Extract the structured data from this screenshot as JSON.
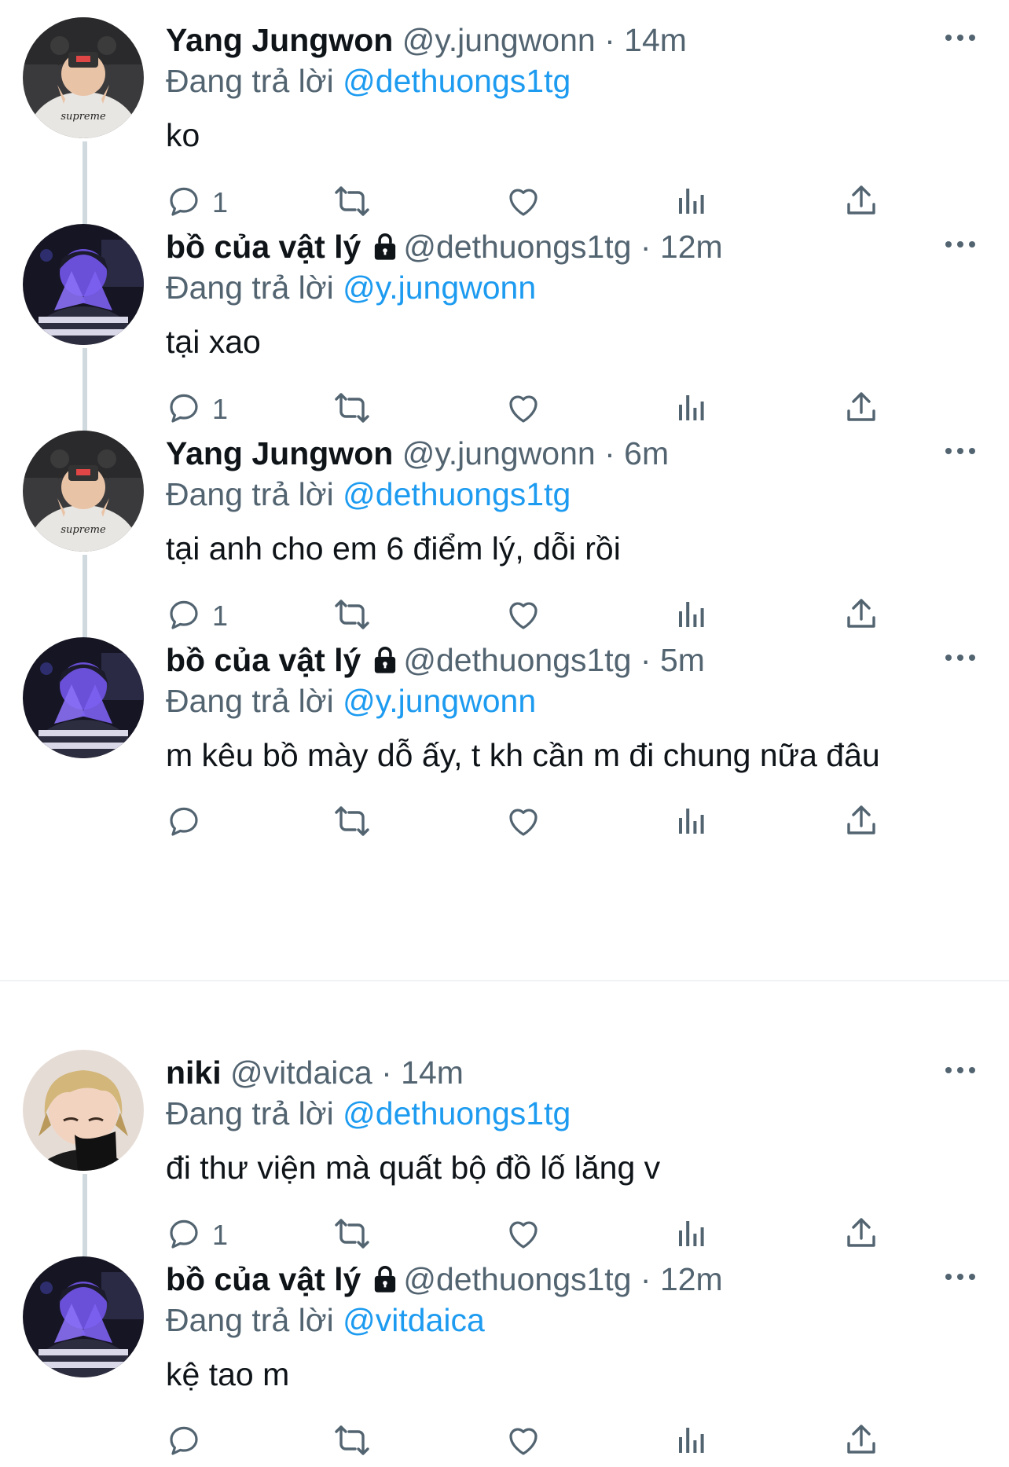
{
  "tweets": [
    {
      "name": "Yang Jungwon",
      "handle": "@y.jungwonn",
      "time": "· 14m",
      "locked": false,
      "reply_prefix": "Đang trả lời",
      "reply_to": "@dethuongs1tg",
      "text": "ko",
      "reply_count": "1",
      "avatar": "avatar-jungwon"
    },
    {
      "name": "bồ của vật lý",
      "handle": "@dethuongs1tg",
      "time": "· 12m",
      "locked": true,
      "reply_prefix": "Đang trả lời",
      "reply_to": "@y.jungwonn",
      "text": "tại xao",
      "reply_count": "1",
      "avatar": "avatar-blue"
    },
    {
      "name": "Yang Jungwon",
      "handle": "@y.jungwonn",
      "time": "· 6m",
      "locked": false,
      "reply_prefix": "Đang trả lời",
      "reply_to": "@dethuongs1tg",
      "text": "tại anh cho em 6 điểm lý, dỗi rồi",
      "reply_count": "1",
      "avatar": "avatar-jungwon"
    },
    {
      "name": "bồ của vật lý",
      "handle": "@dethuongs1tg",
      "time": "· 5m",
      "locked": true,
      "reply_prefix": "Đang trả lời",
      "reply_to": "@y.jungwonn",
      "text": "m kêu bồ mày dỗ ấy, t kh cần m đi chung nữa đâu",
      "reply_count": "",
      "avatar": "avatar-blue"
    },
    {
      "name": "niki",
      "handle": "@vitdaica",
      "time": "· 14m",
      "locked": false,
      "reply_prefix": "Đang trả lời",
      "reply_to": "@dethuongs1tg",
      "text": "đi thư viện mà quất bộ đồ lố lăng v",
      "reply_count": "1",
      "avatar": "avatar-niki"
    },
    {
      "name": "bồ của vật lý",
      "handle": "@dethuongs1tg",
      "time": "· 12m",
      "locked": true,
      "reply_prefix": "Đang trả lời",
      "reply_to": "@vitdaica",
      "text": "kệ tao m",
      "reply_count": "",
      "avatar": "avatar-blue"
    }
  ],
  "icons": {
    "reply": "reply-icon",
    "retweet": "retweet-icon",
    "like": "heart-icon",
    "views": "views-icon",
    "share": "share-icon",
    "more": "more-icon",
    "lock": "lock-icon"
  },
  "colors": {
    "link": "#1d9bf0",
    "secondary": "#536471",
    "thread_line": "#cfd9de"
  }
}
